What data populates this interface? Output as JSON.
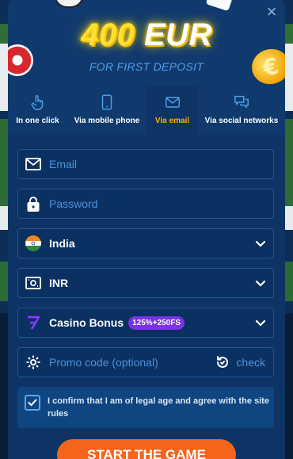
{
  "close_label": "×",
  "hero": {
    "amount": "400",
    "currency": "EUR",
    "subtitle": "FOR FIRST DEPOSIT"
  },
  "tabs": [
    {
      "label": "In one click",
      "icon": "hand-pointer-icon",
      "active": false
    },
    {
      "label": "Via mobile phone",
      "icon": "phone-icon",
      "active": false
    },
    {
      "label": "Via email",
      "icon": "envelope-icon",
      "active": true
    },
    {
      "label": "Via social networks",
      "icon": "chat-bubbles-icon",
      "active": false
    }
  ],
  "form": {
    "email_placeholder": "Email",
    "password_placeholder": "Password",
    "country": "India",
    "currency": "INR",
    "bonus_label": "Casino Bonus",
    "bonus_badge": "125%+250FS",
    "promo_placeholder": "Promo code (optional)",
    "promo_check": "check",
    "consent_text": "I confirm that I am of legal age and agree with the site rules",
    "consent_checked": true
  },
  "cta_label": "START THE GAME",
  "colors": {
    "accent_yellow": "#ffb000",
    "cta_orange": "#f5641b",
    "bonus_purple": "#7a33e6",
    "panel": "#0d3464"
  }
}
